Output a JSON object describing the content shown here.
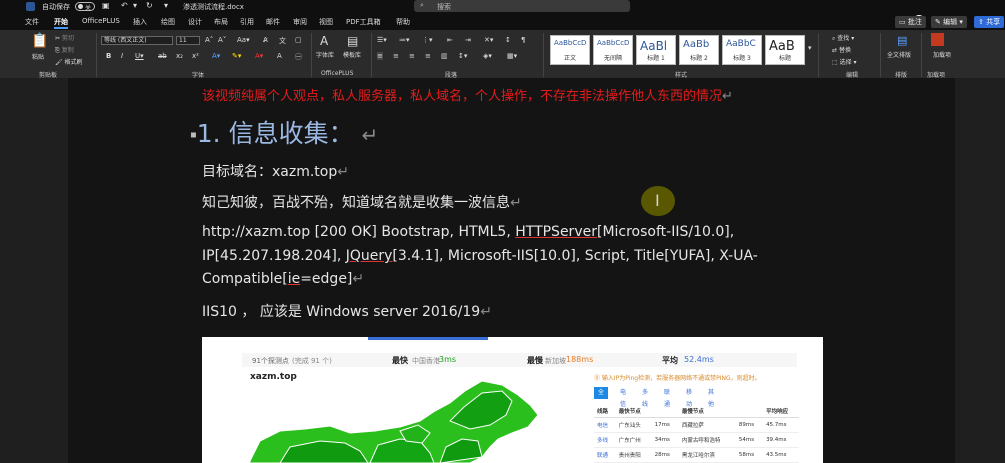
{
  "titlebar": {
    "autosave_label": "自动保存",
    "autosave_state": "关",
    "doc_title": "渗透测试流程.docx",
    "search_placeholder": "搜索"
  },
  "tabs": [
    "文件",
    "开始",
    "OfficePLUS",
    "插入",
    "绘图",
    "设计",
    "布局",
    "引用",
    "邮件",
    "审阅",
    "视图",
    "PDF工具箱",
    "帮助"
  ],
  "active_tab": "开始",
  "right_buttons": {
    "comment": "批注",
    "edit": "编辑",
    "share": "共享"
  },
  "ribbon": {
    "clipboard": {
      "paste": "粘贴",
      "cut": "剪切",
      "copy": "复制",
      "format_painter": "格式刷",
      "label": "剪贴板"
    },
    "font": {
      "font_name": "等线 (西文正文)",
      "font_size": "11",
      "label": "字体"
    },
    "officeplus": {
      "font_lib": "字体库",
      "template": "模板库",
      "label": "OfficePLUS"
    },
    "paragraph": {
      "label": "段落"
    },
    "styles": {
      "items": [
        {
          "sample": "AaBbCcD",
          "name": "正文"
        },
        {
          "sample": "AaBbCcD",
          "name": "无间隔"
        },
        {
          "sample": "AaBl",
          "name": "标题 1"
        },
        {
          "sample": "AaBb",
          "name": "标题 2"
        },
        {
          "sample": "AaBbC",
          "name": "标题 3"
        },
        {
          "sample": "AaB",
          "name": "标题"
        }
      ],
      "label": "样式"
    },
    "editing": {
      "find": "查找",
      "replace": "替换",
      "select": "选择",
      "label": "编辑"
    },
    "layout": {
      "full": "全文排版",
      "label": "排版"
    },
    "addins": {
      "name": "加载项",
      "label": "加载项"
    }
  },
  "document": {
    "red_notice": "该视频纯属个人观点，私人服务器，私人域名，个人操作，不存在非法操作他人东西的情况",
    "heading": "1. 信息收集：",
    "target_line": "目标域名：xazm.top",
    "know_line": "知己知彼，百战不殆，知道域名就是收集一波信息",
    "scan_line1_a": "http://xazm.top [200 OK] Bootstrap, HTML5, ",
    "scan_line1_u": "HTTPServer",
    "scan_line1_b": "[Microsoft-IIS/10.0],",
    "scan_line2_a": "IP[45.207.198.204], ",
    "scan_line2_u": "JQuery",
    "scan_line2_b": "[3.4.1], Microsoft-IIS[10.0], Script, Title[YUFA], X-UA-",
    "scan_line3_a": "Compatible[",
    "scan_line3_u": "ie",
    "scan_line3_b": "=edge]",
    "iis_line": "IIS10 ，  应该是 Windows server 2016/19",
    "return_mark": "↵"
  },
  "ping_shot": {
    "stats_nodes": "91个探测点",
    "stats_nodes_detail": "(完成 91 个)",
    "fastest_label": "最快",
    "fastest_node": "中国香港",
    "fastest_value": "3ms",
    "slowest_label": "最慢",
    "slowest_node": "新加坡",
    "slowest_value": "188ms",
    "avg_label": "平均",
    "avg_value": "52.4ms",
    "domain": "xazm.top",
    "hint": "输入IP为Ping检测，若服务器网络不通或禁PING，则超时。",
    "tabs": [
      "全部",
      "电信",
      "多线",
      "联通",
      "移动",
      "其他"
    ],
    "table_headers": [
      "线路",
      "最快节点",
      "最慢节点",
      "平均响应"
    ],
    "rows": [
      [
        "电信",
        "广东汕头",
        "17ms",
        "西藏拉萨",
        "89ms",
        "45.7ms"
      ],
      [
        "多线",
        "广东广州",
        "34ms",
        "内蒙古呼和浩特",
        "54ms",
        "39.4ms"
      ],
      [
        "联通",
        "贵州贵阳",
        "28ms",
        "黑龙江哈尔滨",
        "58ms",
        "43.5ms"
      ]
    ],
    "map_colors": {
      "light": "#2bbf1d",
      "dark": "#0f9a0f",
      "border": "#ffffff"
    }
  }
}
